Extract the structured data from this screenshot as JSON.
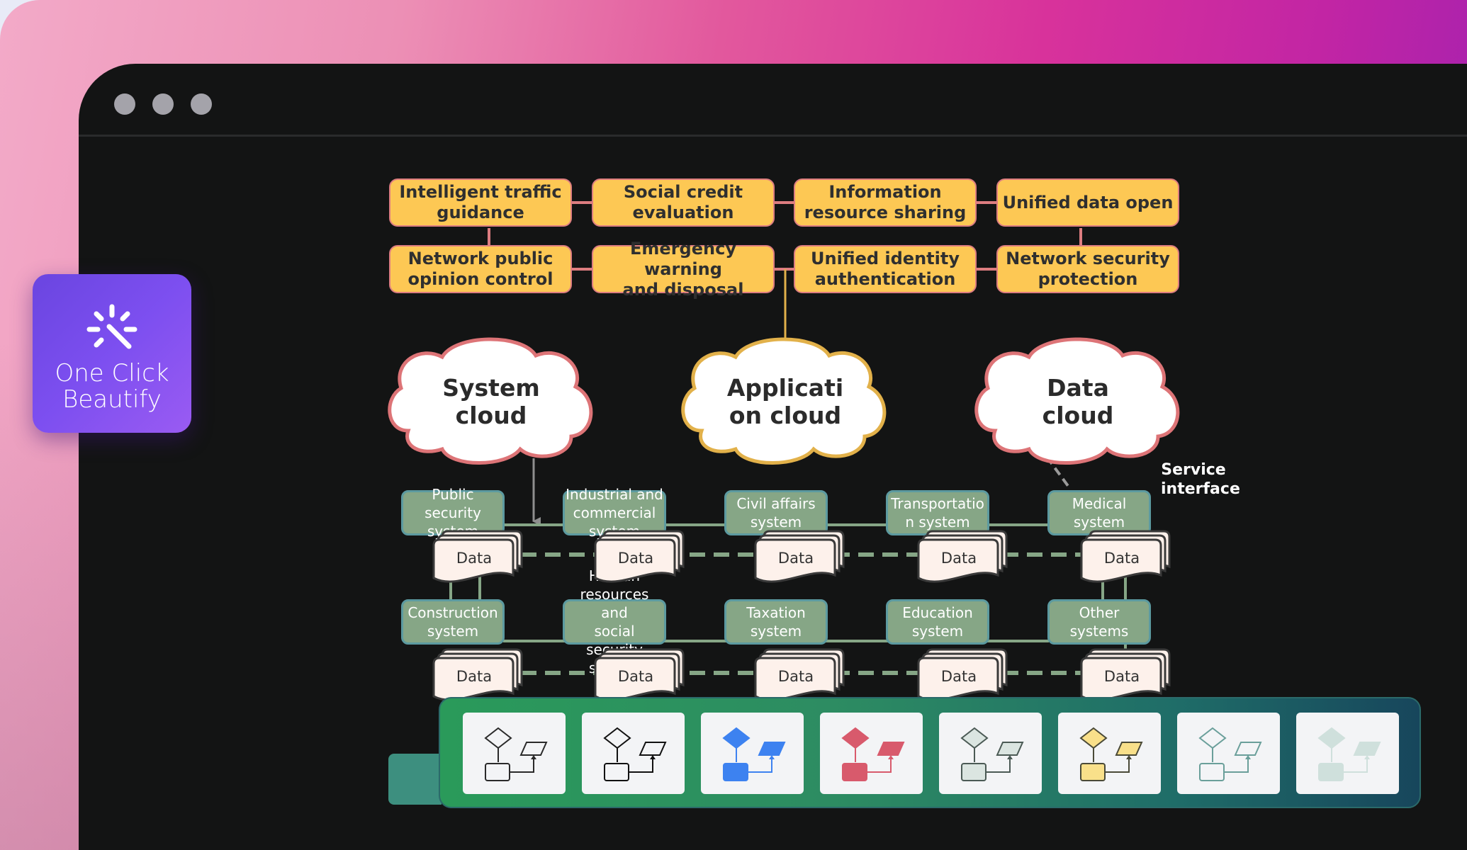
{
  "window": {
    "traffic_lights": [
      "window-dot-1",
      "window-dot-2",
      "window-dot-3"
    ]
  },
  "badge": {
    "icon": "magic-wand-sparkle-icon",
    "label_line1": "One Click",
    "label_line2": "Beautify"
  },
  "diagram": {
    "top_boxes": [
      {
        "line1": "Intelligent traffic",
        "line2": "guidance"
      },
      {
        "line1": "Social credit",
        "line2": "evaluation"
      },
      {
        "line1": "Information",
        "line2": "resource sharing"
      },
      {
        "line1": "Unified data open",
        "line2": ""
      },
      {
        "line1": "Network public",
        "line2": "opinion control"
      },
      {
        "line1": "Emergency warning",
        "line2": "and disposal"
      },
      {
        "line1": "Unified identity",
        "line2": "authentication"
      },
      {
        "line1": "Network security",
        "line2": "protection"
      }
    ],
    "clouds": [
      {
        "line1": "System",
        "line2": "cloud",
        "stroke": "#dd7477"
      },
      {
        "line1": "Applicati",
        "line2": "on cloud",
        "stroke": "#e2b14a"
      },
      {
        "line1": "Data",
        "line2": "cloud",
        "stroke": "#dd7477"
      }
    ],
    "service_interface": {
      "line1": "Service",
      "line2": "interface"
    },
    "systems_row1": [
      {
        "lines": [
          "Public",
          "security",
          "system"
        ]
      },
      {
        "lines": [
          "Industrial and",
          "commercial",
          "system"
        ]
      },
      {
        "lines": [
          "Civil affairs",
          "system"
        ]
      },
      {
        "lines": [
          "Transportatio",
          "n system"
        ]
      },
      {
        "lines": [
          "Medical",
          "system"
        ]
      }
    ],
    "systems_row2": [
      {
        "lines": [
          "Construction",
          "system"
        ]
      },
      {
        "lines": [
          "Human",
          "resources and",
          "social security",
          "system"
        ]
      },
      {
        "lines": [
          "Taxation",
          "system"
        ]
      },
      {
        "lines": [
          "Education",
          "system"
        ]
      },
      {
        "lines": [
          "Other",
          "systems"
        ]
      }
    ],
    "data_label": "Data",
    "colors": {
      "yellow_fill": "#fdc854",
      "yellow_border": "#dd7d80",
      "green_fill": "#86a686",
      "green_border": "#5c9aa0",
      "data_fill": "#fdf1eb",
      "dash_line": "#86a686",
      "arrow_gold": "#e2b14a"
    }
  },
  "style_toolbar": {
    "presets": [
      {
        "name": "style-outline-light",
        "stroke": "#2a2a2a",
        "fill": "none"
      },
      {
        "name": "style-outline-bold",
        "stroke": "#111111",
        "fill": "none"
      },
      {
        "name": "style-blue",
        "stroke": "#3d82f0",
        "fill": "#3d82f0"
      },
      {
        "name": "style-red",
        "stroke": "#d85a6c",
        "fill": "#d85a6c"
      },
      {
        "name": "style-gray-green",
        "stroke": "#4b5a55",
        "fill": "#dbe5e1"
      },
      {
        "name": "style-yellow",
        "stroke": "#4a4a38",
        "fill": "#f9e08a"
      },
      {
        "name": "style-teal-outline",
        "stroke": "#6a9f9a",
        "fill": "none"
      },
      {
        "name": "style-mint",
        "stroke": "#cfe0dc",
        "fill": "#cfe0dc"
      }
    ]
  }
}
